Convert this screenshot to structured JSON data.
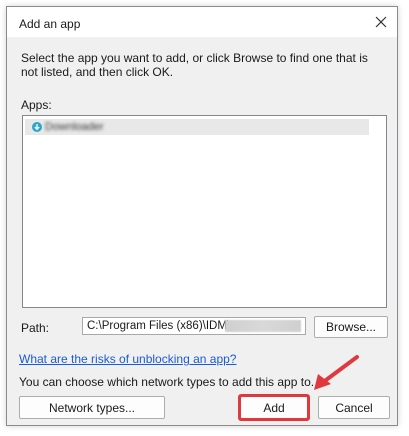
{
  "dialog": {
    "title": "Add an app",
    "instructions": "Select the app you want to add, or click Browse to find one that is not listed, and then click OK.",
    "apps_label": "Apps:",
    "apps": [
      {
        "name": "Downloader"
      }
    ],
    "path_label": "Path:",
    "path_value": "C:\\Program Files (x86)\\IDM\\",
    "browse_label": "Browse...",
    "risk_link": "What are the risks of unblocking an app?",
    "network_note": "You can choose which network types to add this app to.",
    "network_types_label": "Network types...",
    "add_label": "Add",
    "cancel_label": "Cancel"
  },
  "colors": {
    "highlight": "#e0383f",
    "link": "#1a5bd6"
  }
}
